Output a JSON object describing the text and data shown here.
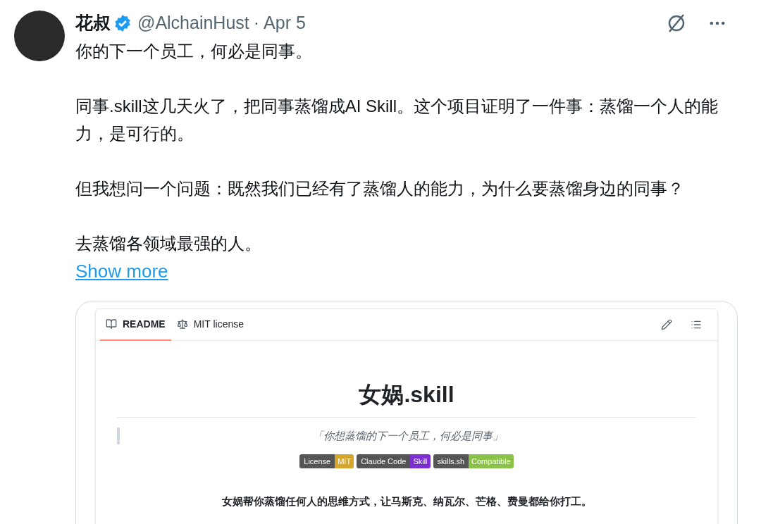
{
  "tweet": {
    "author": "花叔",
    "handle": "@AlchainHust",
    "separator": "·",
    "date": "Apr 5",
    "verified": true,
    "paragraphs": [
      "你的下一个员工，何必是同事。",
      "同事.skill这几天火了，把同事蒸馏成AI Skill。这个项目证明了一件事：蒸馏一个人的能力，是可行的。",
      "但我想问一个问题：既然我们已经有了蒸馏人的能力，为什么要蒸馏身边的同事？",
      "去蒸馏各领域最强的人。"
    ],
    "show_more": "Show more"
  },
  "readme": {
    "tabs": [
      {
        "label": "README",
        "selected": true,
        "kind": "book"
      },
      {
        "label": "MIT license",
        "selected": false,
        "kind": "scale"
      }
    ],
    "title": "女娲.skill",
    "quote": "「你想蒸馏的下一个员工，何必是同事」",
    "badges": [
      {
        "label": "License",
        "value": "MIT",
        "color": "#d4a72c"
      },
      {
        "label": "Claude Code",
        "value": "Skill",
        "color": "#7b2fd0"
      },
      {
        "label": "skills.sh",
        "value": "Compatible",
        "color": "#8bc34a"
      }
    ],
    "summary": "女娲帮你蒸馏任何人的思维方式，让马斯克、纳瓦尔、芒格、费曼都给你打工。"
  }
}
